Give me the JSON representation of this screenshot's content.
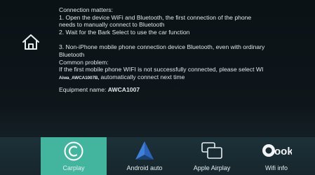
{
  "instructions": {
    "line1": "Connection matters:",
    "line2": "1. Open the device WiFi and Bluetooth, the first connection of the phone",
    "line3": "needs to manually connect to Bluetooth",
    "line4": "2. Wait for the Bark Select to use the car function",
    "line5": "3. Non-iPhone mobile phone connection device Bluetooth, even with ordinary",
    "line6": "Bluetooth",
    "line7": "Common problem:",
    "line8": "If the first mobile phone WIFI is not successfully connected, please select WI",
    "line9_ssid": "Aiwa_AWCA1007B,",
    "line9_rest": " automatically connect next time",
    "equipment_label": "Equipment name: ",
    "equipment_value": "AWCA1007"
  },
  "bottom_bar": {
    "items": [
      {
        "label": "Carplay",
        "icon": "carplay-icon",
        "active": true
      },
      {
        "label": "Android auto",
        "icon": "android-auto-icon",
        "active": false
      },
      {
        "label": "Apple Airplay",
        "icon": "airplay-screens-icon",
        "active": false
      },
      {
        "label": "Wifi info",
        "icon": "look-icon",
        "active": false
      }
    ]
  },
  "colors": {
    "active": "#43b49e",
    "background": "#0c1317",
    "text": "#dfe7ea"
  }
}
